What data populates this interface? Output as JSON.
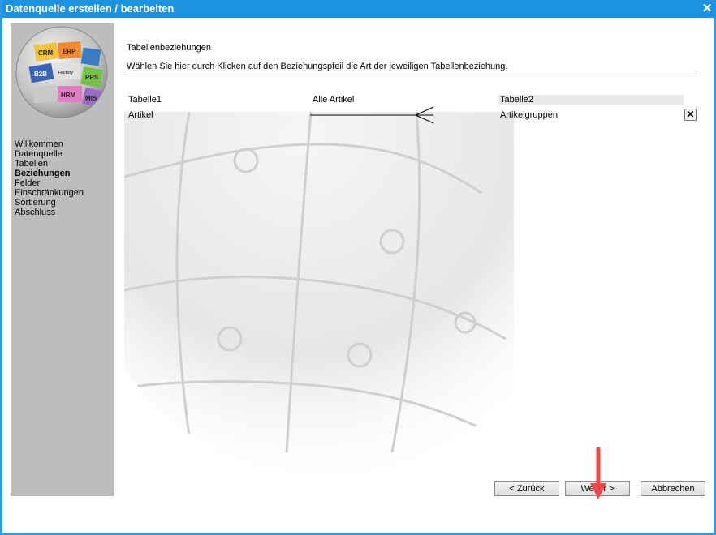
{
  "window": {
    "title": "Datenquelle erstellen / bearbeiten"
  },
  "sidebar": {
    "logo_labels": [
      "CRM",
      "ERP",
      "B2B",
      "PPS",
      "HRM",
      "MIS",
      "Factory"
    ],
    "items": [
      {
        "label": "Willkommen",
        "active": false
      },
      {
        "label": "Datenquelle",
        "active": false
      },
      {
        "label": "Tabellen",
        "active": false
      },
      {
        "label": "Beziehungen",
        "active": true
      },
      {
        "label": "Felder",
        "active": false
      },
      {
        "label": "Einschränkungen",
        "active": false
      },
      {
        "label": "Sortierung",
        "active": false
      },
      {
        "label": "Abschluss",
        "active": false
      }
    ]
  },
  "main": {
    "heading": "Tabellenbeziehungen",
    "description": "Wählen Sie hier durch Klicken auf den Beziehungspfeil die Art der jeweiligen Tabellenbeziehung.",
    "headers": {
      "table1": "Tabelle1",
      "relation": "Alle Artikel",
      "table2": "Tabelle2"
    },
    "row": {
      "table1": "Artikel",
      "table2": "Artikelgruppen",
      "remove_label": "✕"
    }
  },
  "buttons": {
    "back": "< Zurück",
    "next": "Weiter >",
    "cancel": "Abbrechen"
  },
  "colors": {
    "titlebar": "#1c93e0",
    "sidebar": "#bdbdbd",
    "annotation_arrow": "#f04848"
  }
}
